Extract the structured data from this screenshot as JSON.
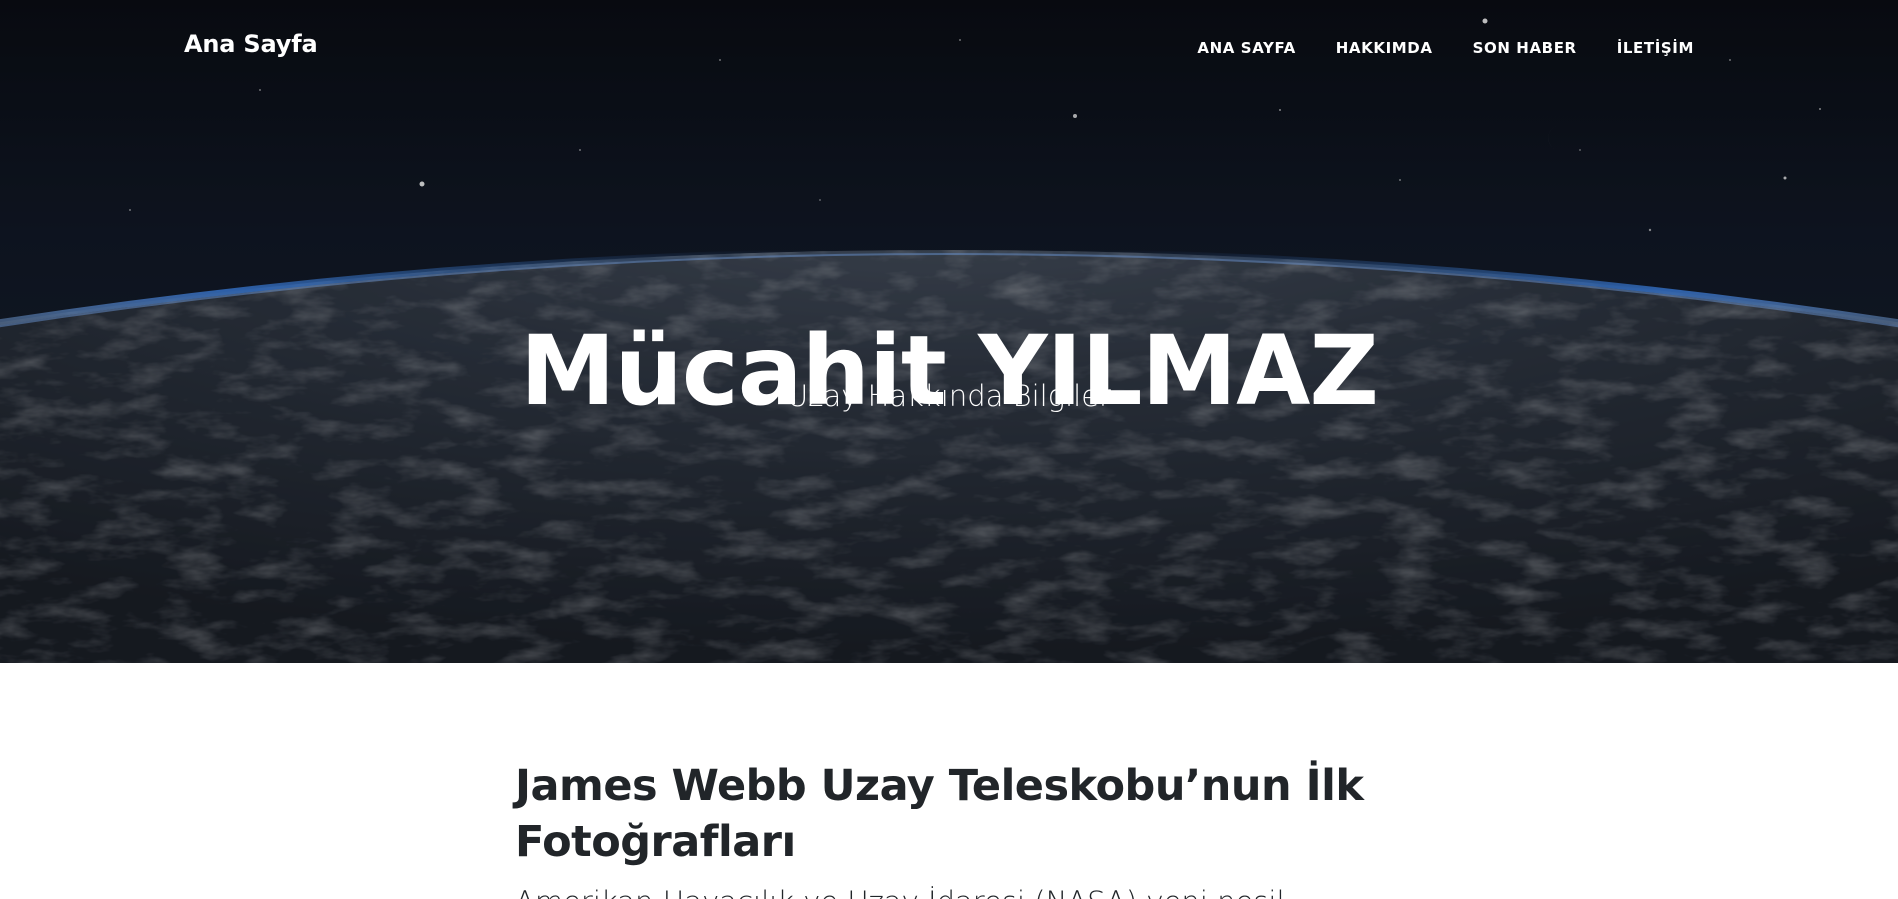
{
  "navbar": {
    "brand": "Ana Sayfa",
    "links": [
      {
        "label": "ANA SAYFA"
      },
      {
        "label": "HAKKIMDA"
      },
      {
        "label": "SON HABER"
      },
      {
        "label": "İLETİŞİM"
      }
    ]
  },
  "hero": {
    "title": "Mücahit YILMAZ",
    "subtitle": "Uzay Hakkında Bilgiler",
    "background": "earth-from-space-image"
  },
  "post": {
    "title": "James Webb Uzay Teleskobu’nun İlk Fotoğrafları",
    "subtitle": "Amerikan Havacılık ve Uzay İdaresi (NASA) yeni nesil"
  },
  "colors": {
    "text_dark": "#212529",
    "nav_text": "#ffffff",
    "space_bg": "#0b0f17",
    "atmosphere": "#3b7fe0"
  }
}
